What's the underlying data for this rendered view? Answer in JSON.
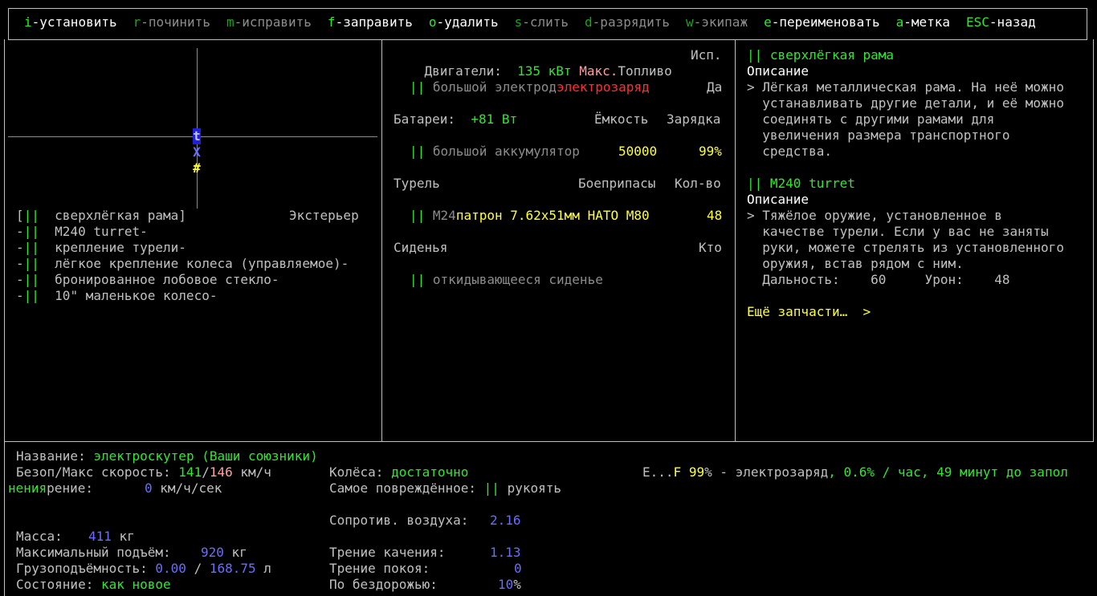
{
  "keybar": [
    {
      "key": "i",
      "label": "-установить",
      "active": true
    },
    {
      "key": "r",
      "label": "-починить",
      "active": false
    },
    {
      "key": "m",
      "label": "-исправить",
      "active": false
    },
    {
      "key": "f",
      "label": "-заправить",
      "active": true
    },
    {
      "key": "o",
      "label": "-удалить",
      "active": true
    },
    {
      "key": "s",
      "label": "-слить",
      "active": false
    },
    {
      "key": "d",
      "label": "-разрядить",
      "active": false
    },
    {
      "key": "w",
      "label": "-экипаж",
      "active": false
    },
    {
      "key": "e",
      "label": "-переименовать",
      "active": true
    },
    {
      "key": "a",
      "label": "-метка",
      "active": true
    },
    {
      "key": "ESC",
      "label": "-назад",
      "active": true
    }
  ],
  "map": {
    "top": "t",
    "mid": "X",
    "bot": "#"
  },
  "parts": {
    "header_right": "Экстерьер",
    "items": [
      {
        "prefix": "[",
        "bars": "||",
        "name": "сверхлёгкая рама]"
      },
      {
        "prefix": "-",
        "bars": "||",
        "name": "M240 turret-"
      },
      {
        "prefix": "-",
        "bars": "||",
        "name": "крепление турели-"
      },
      {
        "prefix": "-",
        "bars": "||",
        "name": "лёгкое крепление колеса (управляемое)-"
      },
      {
        "prefix": "-",
        "bars": "||",
        "name": "бронированное лобовое стекло-"
      },
      {
        "prefix": "-",
        "bars": "||",
        "name": "10\" маленькое колесо-"
      }
    ]
  },
  "middle": {
    "engines": {
      "label": "Двигатели:",
      "power": "135 кВт",
      "max": "Макс.",
      "fuel": "Топливо",
      "use": "Исп.",
      "item_bars": "||",
      "item_name": "большой электрод",
      "item_fuel": "электрозаряд",
      "item_use": "Да"
    },
    "batteries": {
      "label": "Батареи:",
      "power": "+81 Вт",
      "capacity": "Ёмкость",
      "charge": "Зарядка",
      "item_bars": "||",
      "item_name": "большой аккумулятор",
      "item_capacity": "50000",
      "item_charge": "99%"
    },
    "turret": {
      "label": "Турель",
      "ammo": "Боеприпасы",
      "count": "Кол-во",
      "item_bars": "||",
      "item_name": "M24",
      "item_ammo": "патрон 7.62x51мм НАТО M80",
      "item_count": "48"
    },
    "seats": {
      "label": "Сиденья",
      "who": "Кто",
      "item_bars": "||",
      "item_name": "откидывающееся сиденье"
    }
  },
  "right": {
    "part1": {
      "bars": "||",
      "name": "сверхлёгкая рама",
      "desc_label": "Описание",
      "desc_lines": [
        "> Лёгкая металлическая рама. На неё можно",
        "  устанавливать другие детали, и её можно",
        "  соединять с другими рамами для",
        "  увеличения размера транспортного",
        "  средства."
      ]
    },
    "part2": {
      "bars": "||",
      "name": "M240 turret",
      "desc_label": "Описание",
      "desc_lines": [
        "> Тяжёлое оружие, установленное в",
        "  качестве турели. Если у вас не заняты",
        "  руки, можете стрелять из установленного",
        "  оружия, встав рядом с ним."
      ],
      "range_label": "  Дальность:",
      "range": "60",
      "dmg_label": "Урон:",
      "dmg": "48"
    },
    "more": "Ещё запчасти…  >"
  },
  "stats": {
    "name_label": "Название:",
    "name": "электроскутер (Ваши союзники)",
    "speed_label": "Безоп/Макс скорость:",
    "speed_safe": "141",
    "speed_sep": "/",
    "speed_max": "146",
    "speed_unit": "км/ч",
    "accel_prefix": "нения",
    "accel_label": "рение:",
    "accel": "0",
    "accel_unit": "км/ч/сек",
    "mass_label": "Масса:",
    "mass": "411",
    "mass_unit": "кг",
    "lift_label": "Максимальный подъём:",
    "lift": "920",
    "lift_unit": "кг",
    "cargo_label": "Грузоподъёмность:",
    "cargo_cur": "0.00",
    "cargo_sep": "/",
    "cargo_max": "168.75",
    "cargo_unit": "л",
    "state_label": "Состояние:",
    "state": "как новое",
    "wheels_label": "Колёса:",
    "wheels": "достаточно",
    "damaged_label": "Самое повреждённое:",
    "damaged_bars": "||",
    "damaged": "рукоять",
    "air_label": "Сопротив. воздуха:",
    "air": "2.16",
    "rolling_label": "Трение качения:",
    "rolling": "1.13",
    "static_label": "Трение покоя:",
    "static": "0",
    "offroad_label": "По бездорожью:",
    "offroad": "10",
    "offroad_unit": "%",
    "fuel_e": "E...",
    "fuel_f": "F",
    "fuel_pct": "99",
    "fuel_pct_unit": "%",
    "fuel_text": " - электрозаряд",
    "fuel_rate": ", 0.6% / час, 49 минут до запол"
  },
  "colors": {
    "green": "#32e632",
    "yellow": "#ffff3c",
    "red": "#ff3030",
    "blue": "#6c6cff",
    "gray": "#8c8c8c"
  }
}
